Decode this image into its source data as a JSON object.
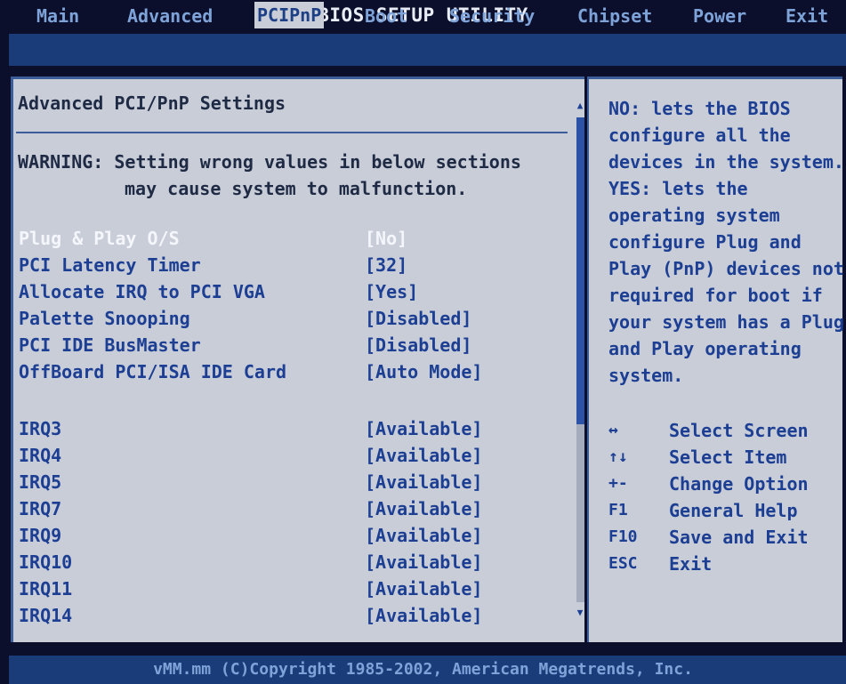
{
  "title": "BIOS SETUP UTILITY",
  "menu": [
    {
      "label": "Main",
      "active": false
    },
    {
      "label": "Advanced",
      "active": false
    },
    {
      "label": "PCIPnP",
      "active": true
    },
    {
      "label": "Boot",
      "active": false
    },
    {
      "label": "Security",
      "active": false
    },
    {
      "label": "Chipset",
      "active": false
    },
    {
      "label": "Power",
      "active": false
    },
    {
      "label": "Exit",
      "active": false
    }
  ],
  "section_title": "Advanced PCI/PnP Settings",
  "warning": {
    "line1": "WARNING: Setting wrong values in below sections",
    "line2": "may cause system to malfunction."
  },
  "settings": [
    {
      "label": "Plug & Play O/S",
      "value": "[No]",
      "selected": true
    },
    {
      "label": "PCI Latency Timer",
      "value": "[32]"
    },
    {
      "label": "Allocate IRQ to PCI VGA",
      "value": "[Yes]"
    },
    {
      "label": "Palette Snooping",
      "value": "[Disabled]"
    },
    {
      "label": "PCI IDE BusMaster",
      "value": "[Disabled]"
    },
    {
      "label": "OffBoard PCI/ISA IDE Card",
      "value": "[Auto Mode]"
    }
  ],
  "irqs": [
    {
      "label": "IRQ3",
      "value": "[Available]"
    },
    {
      "label": "IRQ4",
      "value": "[Available]"
    },
    {
      "label": "IRQ5",
      "value": "[Available]"
    },
    {
      "label": "IRQ7",
      "value": "[Available]"
    },
    {
      "label": "IRQ9",
      "value": "[Available]"
    },
    {
      "label": "IRQ10",
      "value": "[Available]"
    },
    {
      "label": "IRQ11",
      "value": "[Available]"
    },
    {
      "label": "IRQ14",
      "value": "[Available]"
    }
  ],
  "help": {
    "lines": [
      "NO: lets the BIOS",
      "configure all the",
      "devices in the system.",
      "YES: lets the",
      "operating system",
      "configure Plug and",
      "Play (PnP) devices not",
      "required for boot if",
      "your system has a Plug",
      "and Play operating",
      "system."
    ]
  },
  "keys": [
    {
      "key": "↔",
      "desc": "Select Screen"
    },
    {
      "key": "↑↓",
      "desc": "Select Item"
    },
    {
      "key": "+-",
      "desc": "Change Option"
    },
    {
      "key": "F1",
      "desc": "General Help"
    },
    {
      "key": "F10",
      "desc": "Save and Exit"
    },
    {
      "key": "ESC",
      "desc": "Exit"
    }
  ],
  "footer": "vMM.mm (C)Copyright 1985-2002, American Megatrends, Inc.",
  "colors": {
    "background": "#0c0f2c",
    "menu_bar": "#1a3d7a",
    "panel": "#c8cdd8",
    "highlight_text": "#f4f6fb",
    "item_text": "#1c3e93"
  }
}
